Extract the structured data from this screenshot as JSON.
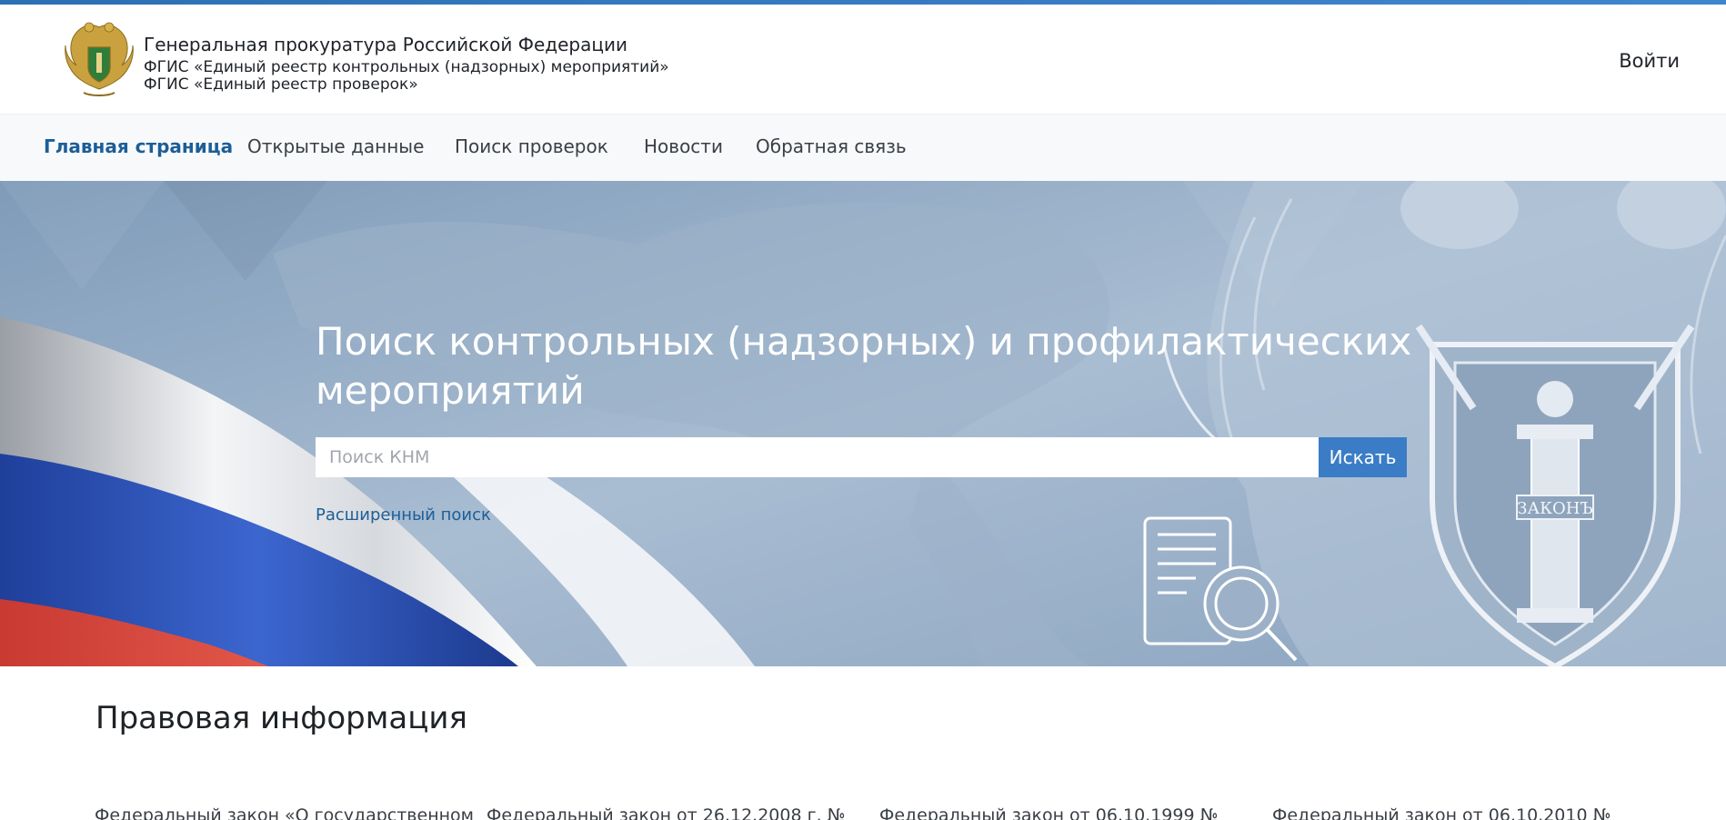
{
  "header": {
    "org_title": "Генеральная прокуратура Российской Федерации",
    "subtitle_1": "ФГИС «Единый реестр контрольных (надзорных) мероприятий»",
    "subtitle_2": "ФГИС «Единый реестр проверок»",
    "login_label": "Войти",
    "logo_icon": "double-headed-eagle-emblem-icon"
  },
  "nav": {
    "items": [
      {
        "label": "Главная страница",
        "active": true
      },
      {
        "label": "Открытые данные",
        "active": false
      },
      {
        "label": "Поиск проверок",
        "active": false
      },
      {
        "label": "Новости",
        "active": false
      },
      {
        "label": "Обратная связь",
        "active": false
      }
    ]
  },
  "hero": {
    "title": "Поиск контрольных (надзорных) и профилактических мероприятий",
    "search_placeholder": "Поиск КНМ",
    "search_value": "",
    "search_button": "Искать",
    "advanced_search": "Расширенный поиск",
    "shield_text": "ЗАКОНЪ"
  },
  "legal": {
    "title": "Правовая информация",
    "laws": [
      "Федеральный закон «О государственном",
      "Федеральный закон от 26.12.2008 г. №",
      "Федеральный закон от 06.10.1999 №",
      "Федеральный закон от 06.10.2010 №"
    ]
  },
  "colors": {
    "accent": "#1c5e97",
    "button": "#3a7dc6",
    "hero_bg": "#8ea7c1",
    "nav_bg": "#f7f9fb",
    "top_bar": "#2d6fb3"
  }
}
